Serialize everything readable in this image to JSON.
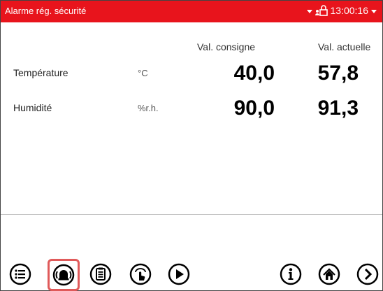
{
  "header": {
    "title": "Alarme rég. sécurité",
    "time": "13:00:16"
  },
  "columns": {
    "setpoint": "Val. consigne",
    "actual": "Val. actuelle"
  },
  "rows": [
    {
      "label": "Température",
      "unit": "°C",
      "setpoint": "40,0",
      "actual": "57,8"
    },
    {
      "label": "Humidité",
      "unit": "%r.h.",
      "setpoint": "90,0",
      "actual": "91,3"
    }
  ],
  "toolbar": {
    "buttons": [
      "menu-icon",
      "alarm-icon",
      "clipboard-icon",
      "manual-operation-icon",
      "play-icon",
      "info-icon",
      "home-icon",
      "next-icon"
    ],
    "active": "alarm-icon"
  },
  "colors": {
    "titlebar": "#e8141c",
    "active_outline": "#e05a5a"
  }
}
